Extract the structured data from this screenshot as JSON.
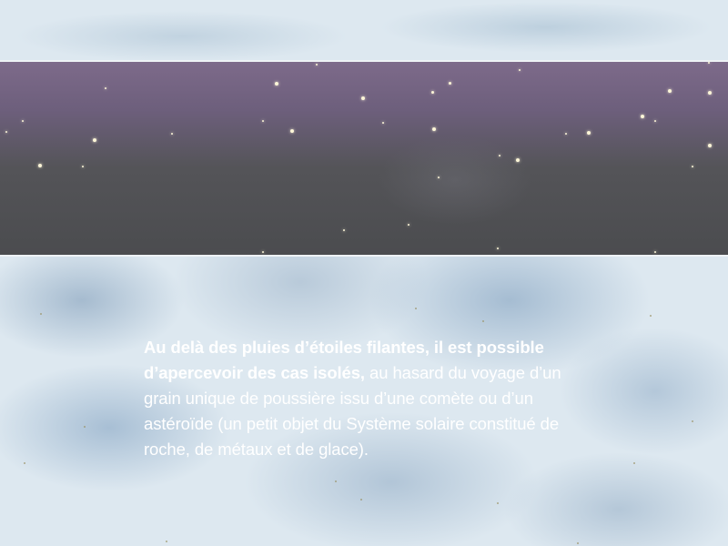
{
  "paragraph": {
    "bold_part": "Au delà des pluies d’étoiles filantes, il est possible d’apercevoir des cas isolés,",
    "regular_part": " au hasard du voyage d’un grain unique de poussière issu d’une comète ou d’un astéroïde (un petit objet du Système solaire constitué de roche, de métaux et de glace)."
  },
  "colors": {
    "band_top": "#7d6a8a",
    "band_bottom": "#4b4c4f",
    "sky_clouds": "#dde8f0",
    "text": "#ffffff"
  }
}
